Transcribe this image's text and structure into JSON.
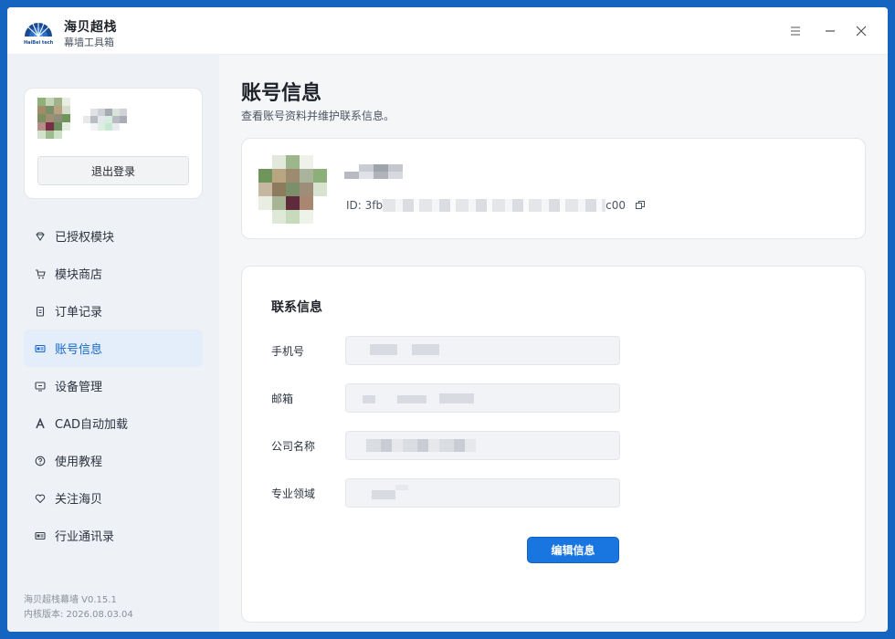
{
  "titlebar": {
    "app_name": "海贝超栈",
    "app_subtitle": "幕墙工具箱",
    "logo_text": "HaiBei tech",
    "menu_icon": "menu-icon",
    "minimize_icon": "minimize-icon",
    "close_icon": "close-icon"
  },
  "sidebar": {
    "logout_label": "退出登录",
    "items": [
      {
        "label": "已授权模块",
        "icon": "diamond-icon"
      },
      {
        "label": "模块商店",
        "icon": "cart-icon"
      },
      {
        "label": "订单记录",
        "icon": "clipboard-icon"
      },
      {
        "label": "账号信息",
        "icon": "id-card-icon",
        "active": true
      },
      {
        "label": "设备管理",
        "icon": "monitor-icon"
      },
      {
        "label": "CAD自动加载",
        "icon": "cad-a-icon"
      },
      {
        "label": "使用教程",
        "icon": "help-circle-icon"
      },
      {
        "label": "关注海贝",
        "icon": "heart-icon"
      },
      {
        "label": "行业通讯录",
        "icon": "address-book-icon"
      }
    ],
    "version_line1": "海贝超栈幕墙 V0.15.1",
    "version_line2": "内核版本: 2026.08.03.04"
  },
  "main": {
    "title": "账号信息",
    "subtitle": "查看账号资料并维护联系信息。",
    "profile": {
      "id_prefix": "ID: 3fb",
      "id_suffix": "c00"
    },
    "contact": {
      "title": "联系信息",
      "fields": [
        {
          "label": "手机号"
        },
        {
          "label": "邮箱"
        },
        {
          "label": "公司名称"
        },
        {
          "label": "专业领域"
        }
      ],
      "edit_label": "编辑信息"
    }
  },
  "colors": {
    "accent": "#1976e0",
    "frame": "#1565c0",
    "active_nav_bg": "#e4eefa"
  }
}
